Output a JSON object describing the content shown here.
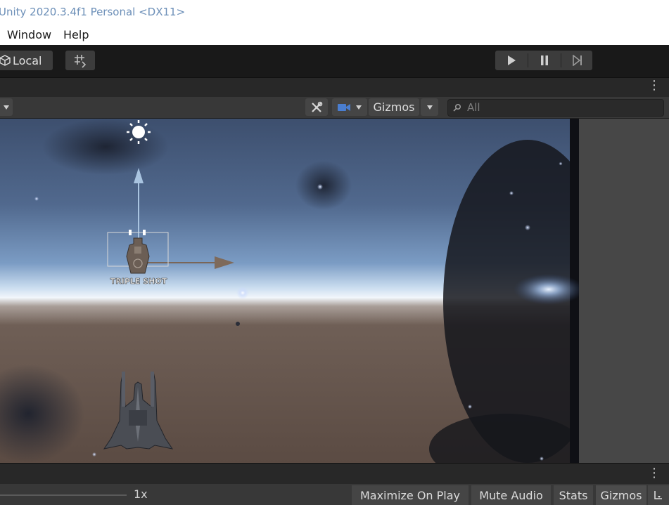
{
  "window": {
    "title": "Unity 2020.3.4f1 Personal <DX11>"
  },
  "menu": {
    "items": [
      "Window",
      "Help"
    ]
  },
  "toolbar": {
    "pivot_mode_label": "Local",
    "grid_snap_icon": "grid-snap-icon",
    "play_icon": "play-icon",
    "pause_icon": "pause-icon",
    "step_icon": "step-icon"
  },
  "scene_toolbar": {
    "gizmos_label": "Gizmos",
    "search_placeholder": "All"
  },
  "scene": {
    "pickup_label": "TRIPLE SHOT"
  },
  "game_toolbar": {
    "scale_label": "1x",
    "maximize_on_play": "Maximize On Play",
    "mute_audio": "Mute Audio",
    "stats": "Stats",
    "gizmos": "Gizmos"
  },
  "colors": {
    "editor_bg": "#191919",
    "toolbar_button": "#3c3c3c",
    "title_text": "#6c8fb8",
    "transform_arrow": "#a9c4e0"
  }
}
